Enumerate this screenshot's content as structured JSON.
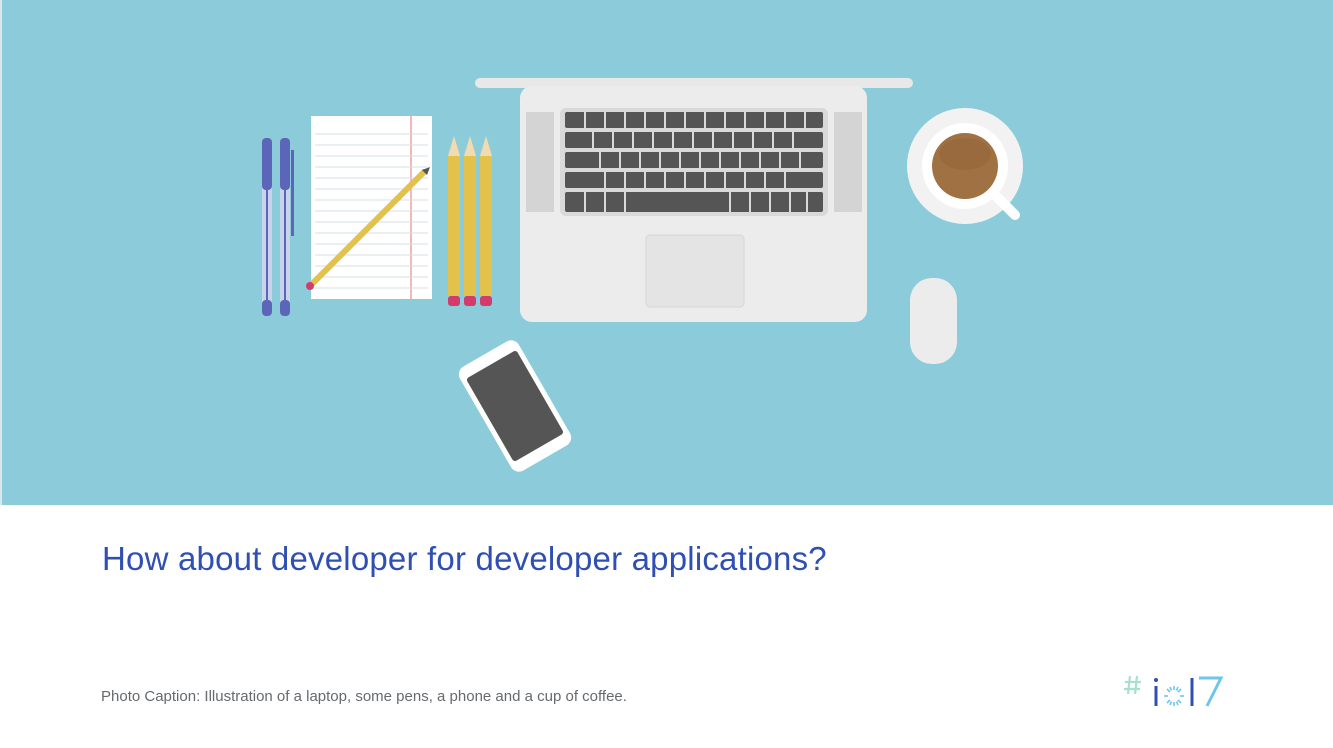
{
  "slide": {
    "title": "How about developer for developer applications?",
    "caption": "Photo Caption: Illustration of a laptop, some pens, a phone and a cup of coffee."
  },
  "illustration": {
    "background_color": "#8ccbd9",
    "objects": [
      "pen-icon",
      "notepad-icon",
      "pencil-icon",
      "laptop-icon",
      "coffee-cup-icon",
      "mouse-icon",
      "phone-icon"
    ]
  },
  "logo": {
    "text": "#io17",
    "colors": [
      "#a6e0cf",
      "#2f4fb3",
      "#6ec6e8"
    ]
  }
}
